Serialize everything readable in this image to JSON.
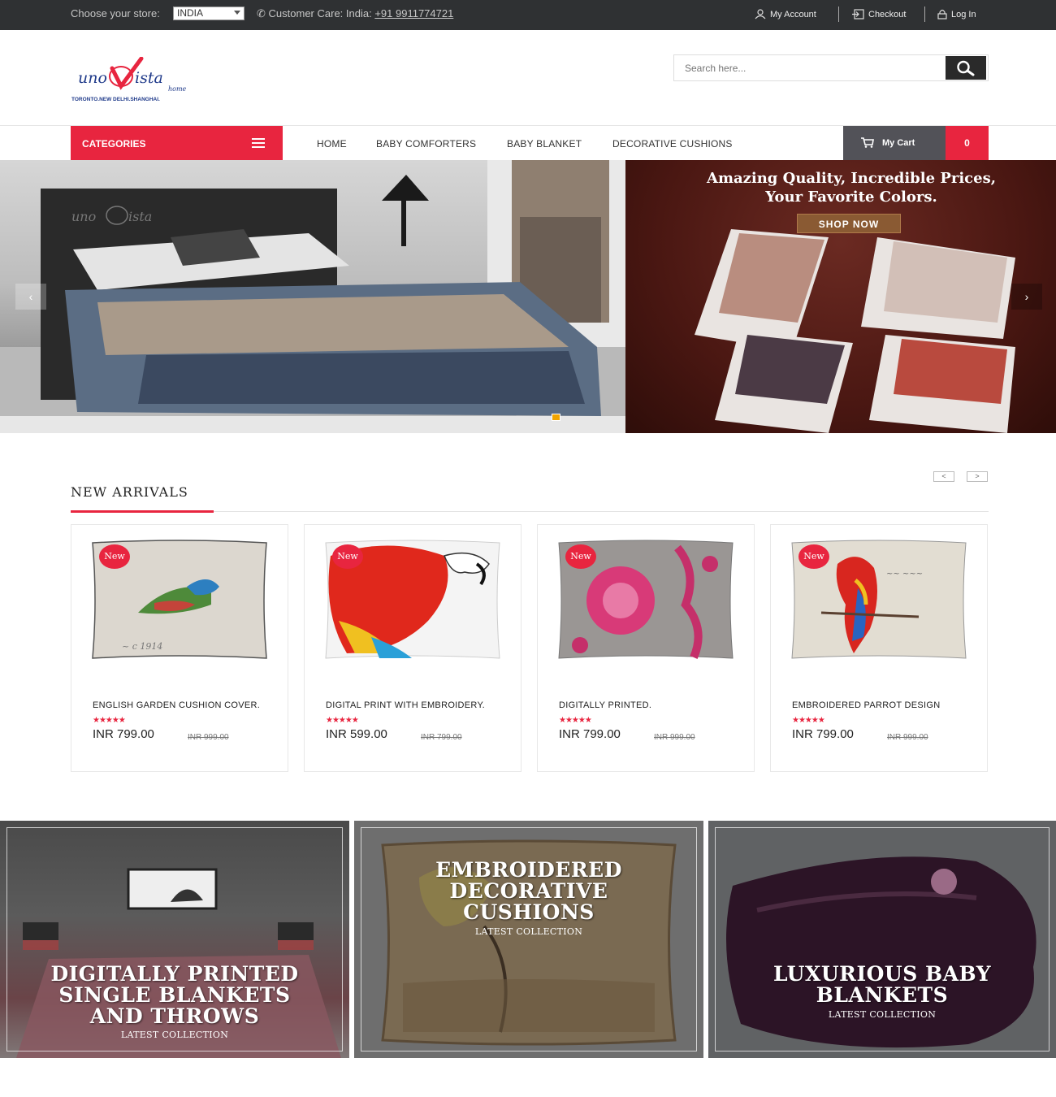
{
  "topbar": {
    "store_label": "Choose your store:",
    "store_value": "INDIA",
    "care_label": "Customer Care: India:",
    "care_phone": "+91 9911774721",
    "my_account": "My Account",
    "checkout": "Checkout",
    "login": "Log In"
  },
  "header": {
    "logo_text": "uno vista",
    "logo_sub": "home",
    "logo_cities": "TORONTO.NEW DELHI.SHANGHAI.",
    "search_placeholder": "Search here..."
  },
  "nav": {
    "categories": "CATEGORIES",
    "items": [
      "HOME",
      "BABY COMFORTERS",
      "BABY BLANKET",
      "DECORATIVE CUSHIONS"
    ],
    "cart_label": "My Cart",
    "cart_count": "0"
  },
  "hero": {
    "headline_1": "Amazing Quality, Incredible Prices,",
    "headline_2": "Your Favorite Colors.",
    "cta": "SHOP NOW",
    "prev": "‹",
    "next": "›"
  },
  "new_arrivals": {
    "title": "NEW ARRIVALS",
    "prev": "<",
    "next": ">",
    "products": [
      {
        "badge": "New",
        "name": "ENGLISH GARDEN CUSHION COVER.",
        "stars": "★★★★★",
        "price": "INR 799.00",
        "old_price": "INR 999.00"
      },
      {
        "badge": "New",
        "name": "DIGITAL PRINT WITH EMBROIDERY.",
        "stars": "★★★★★",
        "price": "INR 599.00",
        "old_price": "INR 799.00"
      },
      {
        "badge": "New",
        "name": "DIGITALLY PRINTED.",
        "stars": "★★★★★",
        "price": "INR 799.00",
        "old_price": "INR 999.00"
      },
      {
        "badge": "New",
        "name": "EMBROIDERED PARROT DESIGN",
        "stars": "★★★★★",
        "price": "INR 799.00",
        "old_price": "INR 999.00"
      }
    ]
  },
  "banners": [
    {
      "line1": "DIGITALLY PRINTED",
      "line2": "SINGLE BLANKETS",
      "line3": "AND THROWS",
      "sub": "LATEST COLLECTION"
    },
    {
      "line1": "EMBROIDERED",
      "line2": "DECORATIVE",
      "line3": "CUSHIONS",
      "sub": "LATEST COLLECTION"
    },
    {
      "line1": "LUXURIOUS BABY",
      "line2": "BLANKETS",
      "sub": "LATEST COLLECTION"
    }
  ],
  "colors": {
    "accent": "#e8253f",
    "topbar": "#2f3133",
    "cart": "#525258"
  }
}
